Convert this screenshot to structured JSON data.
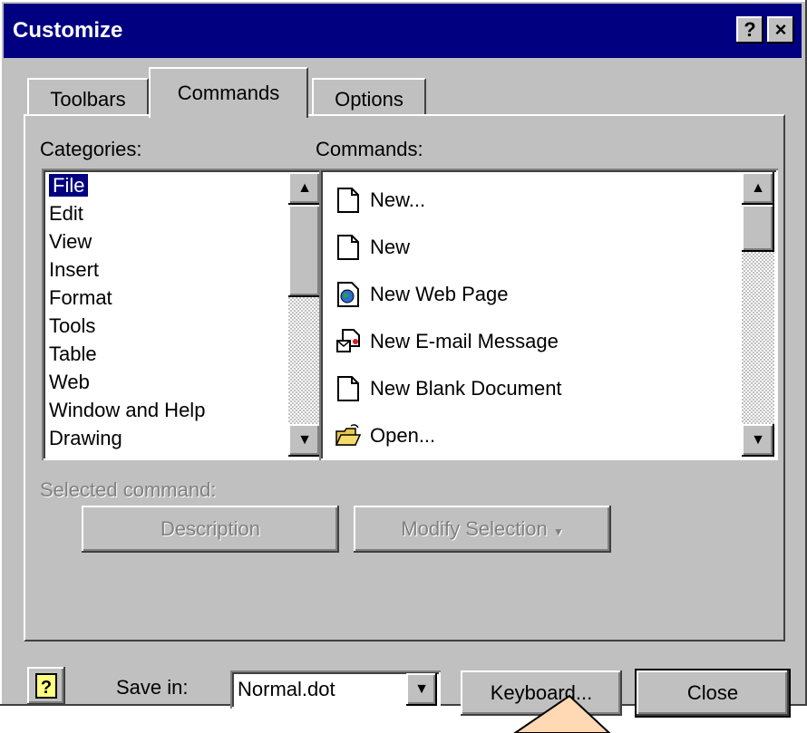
{
  "window": {
    "title": "Customize",
    "help_btn": "?",
    "close_btn": "×"
  },
  "tabs": [
    {
      "label": "Toolbars",
      "active": false
    },
    {
      "label": "Commands",
      "active": true
    },
    {
      "label": "Options",
      "active": false
    }
  ],
  "categories": {
    "label": "Categories:",
    "items": [
      "File",
      "Edit",
      "View",
      "Insert",
      "Format",
      "Tools",
      "Table",
      "Web",
      "Window and Help",
      "Drawing"
    ],
    "selected": "File"
  },
  "commands": {
    "label": "Commands:",
    "items": [
      {
        "label": "New...",
        "icon": "blank-document-icon"
      },
      {
        "label": "New",
        "icon": "blank-document-icon"
      },
      {
        "label": "New Web Page",
        "icon": "web-page-icon"
      },
      {
        "label": "New E-mail Message",
        "icon": "email-message-icon"
      },
      {
        "label": "New Blank Document",
        "icon": "blank-document-icon"
      },
      {
        "label": "Open...",
        "icon": "open-folder-icon"
      }
    ]
  },
  "selected_command": {
    "label": "Selected command:",
    "description_label": "Description",
    "modify_label": "Modify Selection",
    "modify_arrow": "▼"
  },
  "footer": {
    "save_in_label": "Save in:",
    "save_in_value": "Normal.dot",
    "keyboard_label": "Keyboard...",
    "close_label": "Close"
  },
  "colors": {
    "dialog_bg": "#c0c0c0",
    "title_bg": "#000080",
    "selection_bg": "#000080",
    "callout_bg": "#ffd9b3"
  }
}
